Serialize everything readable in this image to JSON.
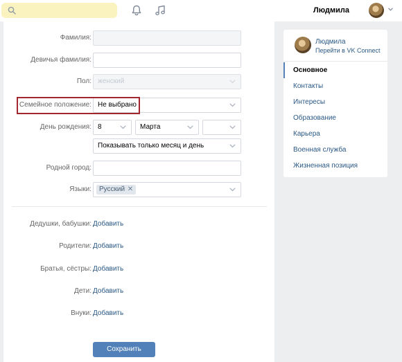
{
  "header": {
    "user_name": "Людмила",
    "search_bg": "#fbf3bf"
  },
  "form": {
    "rows": [
      {
        "label": "Фамилия:",
        "value": ""
      },
      {
        "label": "Девичья фамилия:",
        "value": ""
      },
      {
        "label": "Пол:",
        "value": "женский"
      },
      {
        "label": "Семейное положение:",
        "value": "Не выбрано"
      },
      {
        "label": "День рождения:",
        "day": "8",
        "month": "Марта",
        "year": ""
      },
      {
        "birthday_visibility": "Показывать только месяц и день"
      },
      {
        "label": "Родной город:",
        "value": ""
      },
      {
        "label": "Языки:",
        "tag": "Русский"
      }
    ],
    "relatives": [
      {
        "label": "Дедушки, бабушки:",
        "link": "Добавить"
      },
      {
        "label": "Родители:",
        "link": "Добавить"
      },
      {
        "label": "Братья, сёстры:",
        "link": "Добавить"
      },
      {
        "label": "Дети:",
        "link": "Добавить"
      },
      {
        "label": "Внуки:",
        "link": "Добавить"
      }
    ],
    "save_label": "Сохранить"
  },
  "sidebar": {
    "profile_name": "Людмила",
    "profile_sub": "Перейти в VK Connect",
    "items": [
      {
        "label": "Основное"
      },
      {
        "label": "Контакты"
      },
      {
        "label": "Интересы"
      },
      {
        "label": "Образование"
      },
      {
        "label": "Карьера"
      },
      {
        "label": "Военная служба"
      },
      {
        "label": "Жизненная позиция"
      }
    ]
  },
  "colors": {
    "accent": "#5181b8",
    "link": "#2a5885",
    "highlight_border": "#a3262e"
  }
}
